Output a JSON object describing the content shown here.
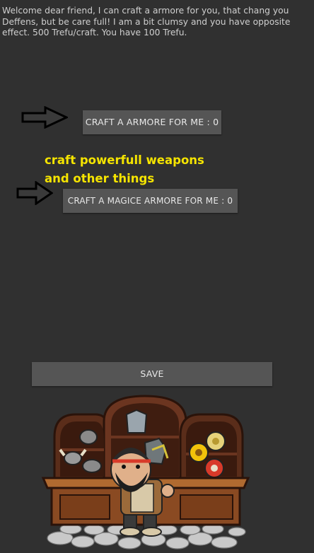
{
  "intro": {
    "lines": [
      "Welcome dear friend, I can craft a armore for you, that chang you",
      "Deffens, but be care full! I am a bit clumsy and you have opposite",
      "effect. 500 Trefu/craft. You have 100 Trefu."
    ]
  },
  "buttons": {
    "craft_armor": "CRAFT A ARMORE FOR ME : 0",
    "craft_magic_armor": "CRAFT A MAGICE ARMORE FOR ME : 0",
    "save": "SAVE"
  },
  "annotation": {
    "lines": [
      "craft powerfull weapons",
      "and other things"
    ],
    "color": "#f5e400"
  },
  "icons": {
    "arrow": "right-arrow-icon",
    "shop": "blacksmith-shop-illustration"
  },
  "colors": {
    "background": "#303030",
    "button": "#555555",
    "text": "#cfcfcf"
  }
}
